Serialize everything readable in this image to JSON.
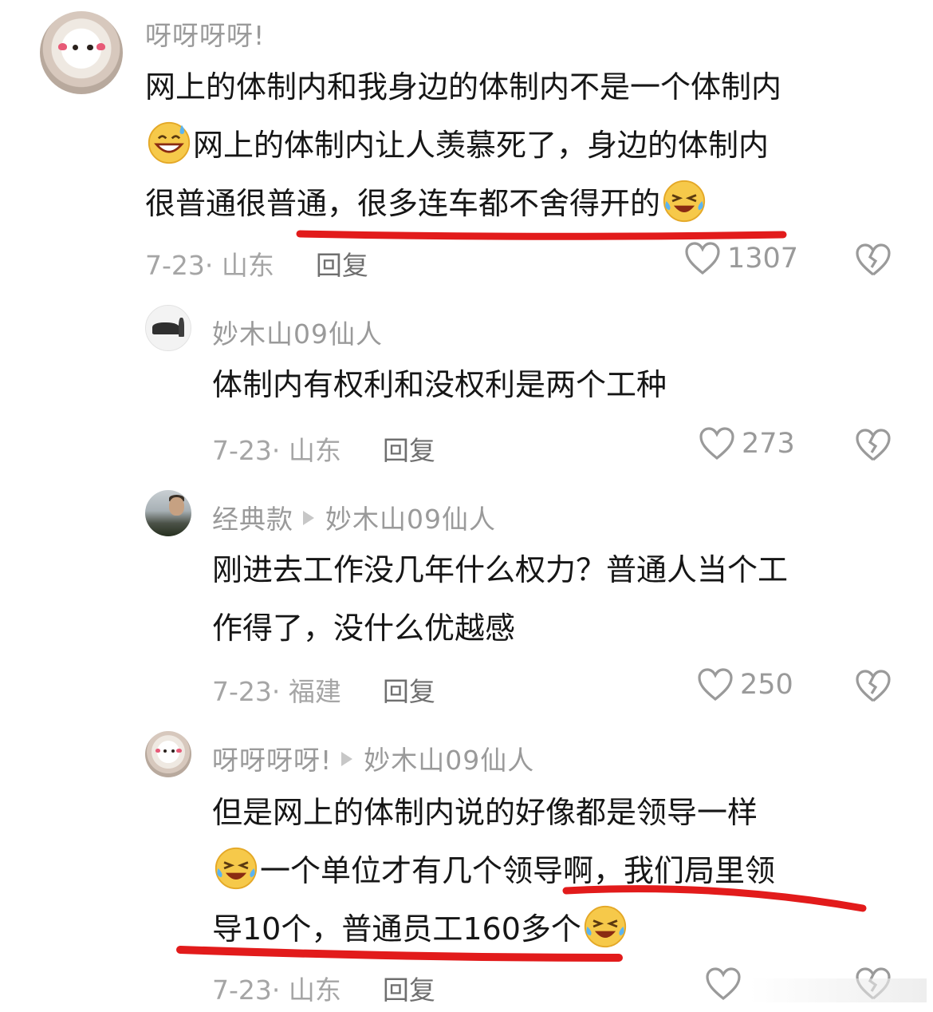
{
  "colors": {
    "background": "#ffffff",
    "username": "#9a9a9a",
    "text": "#161616",
    "meta": "#a5a5a5",
    "annotation_red": "#e21b1b"
  },
  "comments": [
    {
      "username": "呀呀呀呀!",
      "avatar_icon": "dog-avatar-icon",
      "lines": [
        "网上的体制内和我身边的体制内不是一个体制内",
        "网上的体制内让人羡慕死了，身边的体制内",
        "很普通很普通，很多连车都不舍得开的"
      ],
      "date": "7-23",
      "location": "· 山东",
      "reply_label": "回复",
      "likes": "1307"
    },
    {
      "username": "妙木山09仙人",
      "avatar_icon": "car-avatar-icon",
      "lines": [
        "体制内有权利和没权利是两个工种"
      ],
      "date": "7-23",
      "location": "· 山东",
      "reply_label": "回复",
      "likes": "273"
    },
    {
      "username": "经典款",
      "reply_to": "妙木山09仙人",
      "avatar_icon": "man-avatar-icon",
      "lines": [
        "刚进去工作没几年什么权力？普通人当个工",
        "作得了，没什么优越感"
      ],
      "date": "7-23",
      "location": "· 福建",
      "reply_label": "回复",
      "likes": "250"
    },
    {
      "username": "呀呀呀呀!",
      "reply_to": "妙木山09仙人",
      "avatar_icon": "dog-avatar-icon",
      "lines": [
        "但是网上的体制内说的好像都是领导一样",
        "一个单位才有几个领导啊，我们局里领",
        "导10个，普通员工160多个"
      ],
      "date": "7-23",
      "location": "· 山东",
      "reply_label": "回复"
    }
  ]
}
